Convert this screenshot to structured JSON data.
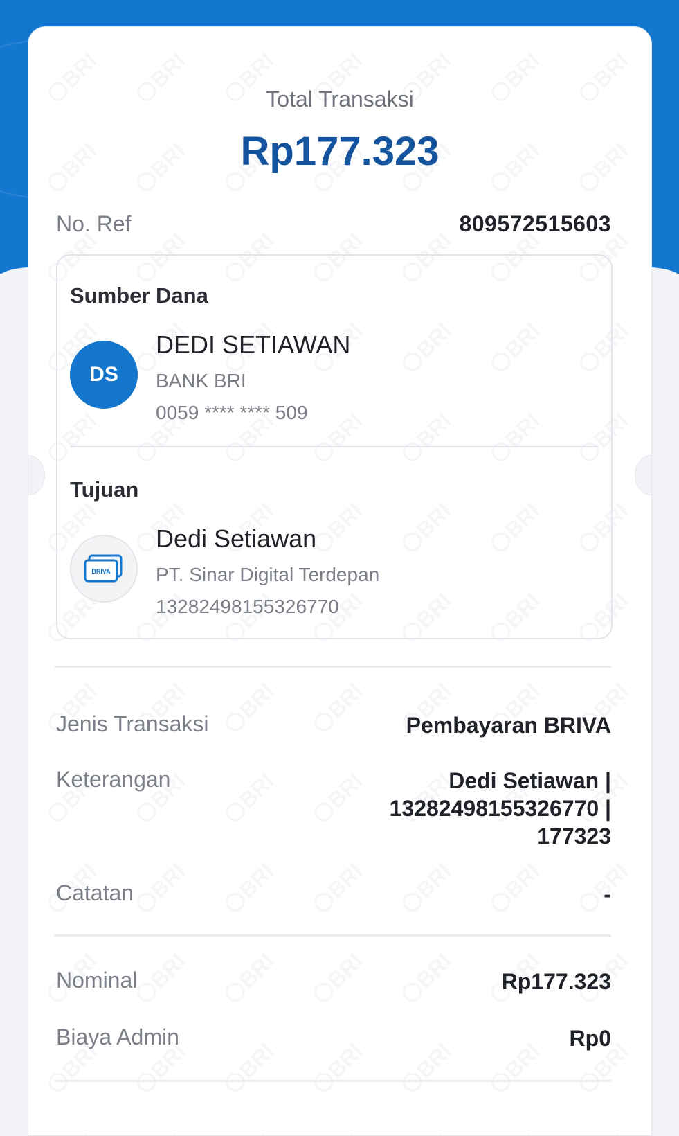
{
  "summary": {
    "total_label": "Total Transaksi",
    "total_amount": "Rp177.323",
    "ref_label": "No. Ref",
    "ref_value": "809572515603"
  },
  "source": {
    "title": "Sumber Dana",
    "initials": "DS",
    "name": "DEDI SETIAWAN",
    "bank": "BANK BRI",
    "account": "0059 **** **** 509"
  },
  "destination": {
    "title": "Tujuan",
    "icon_label": "BRIVA",
    "name": "Dedi Setiawan",
    "company": "PT. Sinar Digital Terdepan",
    "number": "13282498155326770"
  },
  "details": {
    "type_label": "Jenis Transaksi",
    "type_value": "Pembayaran BRIVA",
    "desc_label": "Keterangan",
    "desc_value_1": "Dedi Setiawan |",
    "desc_value_2": "13282498155326770 |",
    "desc_value_3": "177323",
    "note_label": "Catatan",
    "note_value": "-"
  },
  "amounts": {
    "nominal_label": "Nominal",
    "nominal_value": "Rp177.323",
    "admin_label": "Biaya Admin",
    "admin_value": "Rp0"
  },
  "colors": {
    "brand_blue": "#1477cf",
    "amount_blue": "#14549f",
    "background": "#f1f3f6"
  }
}
